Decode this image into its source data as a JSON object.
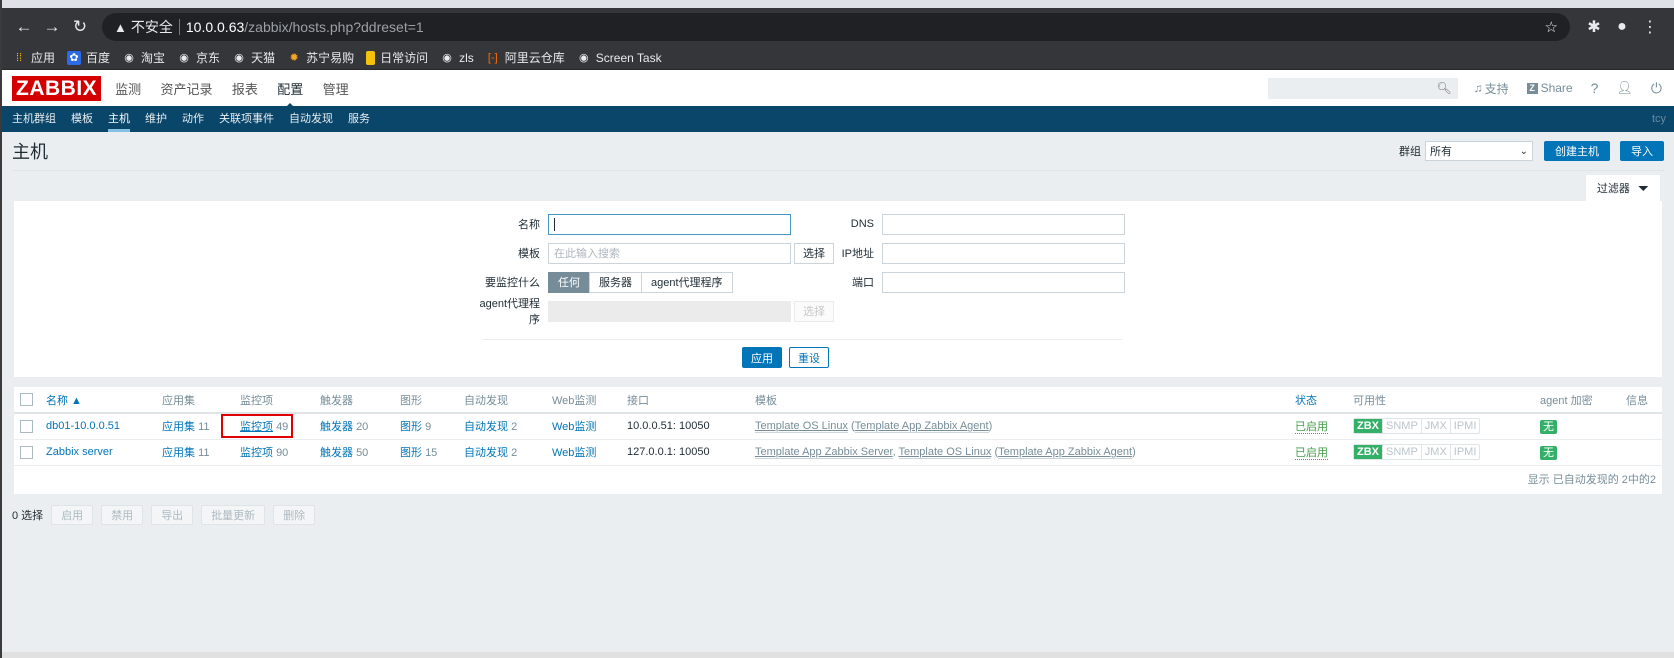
{
  "browser": {
    "insecure_label": "不安全",
    "url_host": "10.0.0.63",
    "url_path": "/zabbix/hosts.php?ddreset=1",
    "bookmarks": [
      {
        "label": "应用",
        "icon": "apps-grid-icon"
      },
      {
        "label": "百度",
        "icon": "baidu-paw-icon"
      },
      {
        "label": "淘宝",
        "icon": "globe-icon"
      },
      {
        "label": "京东",
        "icon": "globe-icon"
      },
      {
        "label": "天猫",
        "icon": "globe-icon"
      },
      {
        "label": "苏宁易购",
        "icon": "suning-icon"
      },
      {
        "label": "日常访问",
        "icon": "folder-icon"
      },
      {
        "label": "zls",
        "icon": "globe-icon"
      },
      {
        "label": "阿里云仓库",
        "icon": "aliyun-icon"
      },
      {
        "label": "Screen Task",
        "icon": "globe-icon"
      }
    ]
  },
  "header": {
    "logo": "ZABBIX",
    "main_menu": [
      "监测",
      "资产记录",
      "报表",
      "配置",
      "管理"
    ],
    "active_main": "配置",
    "support": "支持",
    "share": "Share",
    "help": "?",
    "sub_menu": [
      "主机群组",
      "模板",
      "主机",
      "维护",
      "动作",
      "关联项事件",
      "自动发现",
      "服务"
    ],
    "active_sub": "主机",
    "username": "tcy"
  },
  "page": {
    "title": "主机",
    "group_label": "群组",
    "group_value": "所有",
    "create_host": "创建主机",
    "import": "导入",
    "filter_tab": "过滤器"
  },
  "filter": {
    "name_label": "名称",
    "name_value": "",
    "template_label": "模板",
    "template_placeholder": "在此输入搜索",
    "select_btn": "选择",
    "monitored_by_label": "要监控什么",
    "monitored_by_options": [
      "任何",
      "服务器",
      "agent代理程序"
    ],
    "monitored_by_selected": "任何",
    "proxy_label": "agent代理程序",
    "proxy_select_btn": "选择",
    "dns_label": "DNS",
    "ip_label": "IP地址",
    "port_label": "端口",
    "apply": "应用",
    "reset": "重设"
  },
  "table": {
    "columns": [
      "名称 ▲",
      "应用集",
      "监控项",
      "触发器",
      "图形",
      "自动发现",
      "Web监测",
      "接口",
      "模板",
      "状态",
      "可用性",
      "agent 加密",
      "信息"
    ],
    "rows": [
      {
        "name": "db01-10.0.0.51",
        "applications": {
          "label": "应用集",
          "count": "11"
        },
        "items": {
          "label": "监控项",
          "count": "49"
        },
        "triggers": {
          "label": "触发器",
          "count": "20"
        },
        "graphs": {
          "label": "图形",
          "count": "9"
        },
        "discovery": {
          "label": "自动发现",
          "count": "2"
        },
        "web": "Web监测",
        "interface": "10.0.0.51: 10050",
        "templates_main": "Template OS Linux",
        "templates_paren": "Template App Zabbix Agent",
        "templates_prefix": "",
        "status": "已启用",
        "availability": [
          "ZBX",
          "SNMP",
          "JMX",
          "IPMI"
        ],
        "encryption": "无"
      },
      {
        "name": "Zabbix server",
        "applications": {
          "label": "应用集",
          "count": "11"
        },
        "items": {
          "label": "监控项",
          "count": "90"
        },
        "triggers": {
          "label": "触发器",
          "count": "50"
        },
        "graphs": {
          "label": "图形",
          "count": "15"
        },
        "discovery": {
          "label": "自动发现",
          "count": "2"
        },
        "web": "Web监测",
        "interface": "127.0.0.1: 10050",
        "templates_prefix": "Template App Zabbix Server",
        "templates_main": "Template OS Linux",
        "templates_paren": "Template App Zabbix Agent",
        "status": "已启用",
        "availability": [
          "ZBX",
          "SNMP",
          "JMX",
          "IPMI"
        ],
        "encryption": "无"
      }
    ],
    "footer": "显示 已自动发现的 2中的2"
  },
  "actions": {
    "selected": "0 选择",
    "buttons": [
      "启用",
      "禁用",
      "导出",
      "批量更新",
      "删除"
    ]
  },
  "highlight": {
    "color": "#e00000",
    "target": "监控项 49"
  }
}
